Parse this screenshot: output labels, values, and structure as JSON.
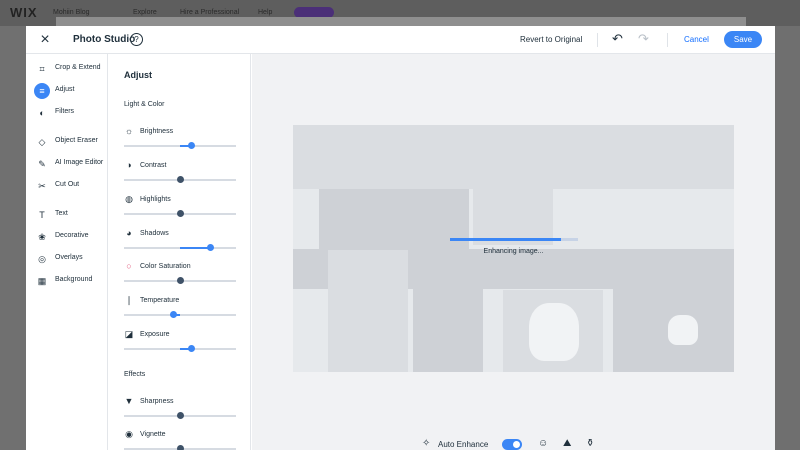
{
  "background": {
    "logo": "WIX",
    "items": [
      "Mohiin Blog",
      "Explore",
      "Hire a Professional",
      "Help"
    ],
    "upgrade": "Upgrade"
  },
  "header": {
    "title": "Photo Studio",
    "help_icon": "?",
    "revert": "Revert to Original",
    "cancel": "Cancel",
    "save": "Save"
  },
  "tools": [
    {
      "label": "Crop & Extend",
      "icon": "crop-icon"
    },
    {
      "label": "Adjust",
      "icon": "sliders-icon"
    },
    {
      "label": "Filters",
      "icon": "filters-icon"
    },
    {
      "label": "Object Eraser",
      "icon": "eraser-icon"
    },
    {
      "label": "AI Image Editor",
      "icon": "ai-edit-icon"
    },
    {
      "label": "Cut Out",
      "icon": "scissors-icon"
    },
    {
      "label": "Text",
      "icon": "text-icon"
    },
    {
      "label": "Decorative",
      "icon": "decorative-icon"
    },
    {
      "label": "Overlays",
      "icon": "overlays-icon"
    },
    {
      "label": "Background",
      "icon": "background-icon"
    }
  ],
  "adjust": {
    "title": "Adjust",
    "section_light": "Light & Color",
    "section_effects": "Effects",
    "controls": [
      {
        "label": "Brightness",
        "value": 0.6
      },
      {
        "label": "Contrast",
        "value": 0.5
      },
      {
        "label": "Highlights",
        "value": 0.5
      },
      {
        "label": "Shadows",
        "value": 0.77
      },
      {
        "label": "Color Saturation",
        "value": 0.5
      },
      {
        "label": "Temperature",
        "value": 0.44
      },
      {
        "label": "Exposure",
        "value": 0.6
      }
    ],
    "effects": [
      {
        "label": "Sharpness",
        "value": 0.5
      },
      {
        "label": "Vignette",
        "value": 0.5
      }
    ]
  },
  "canvas": {
    "status": "Enhancing image...",
    "progress": 0.87
  },
  "bottom": {
    "auto_enhance": "Auto Enhance",
    "auto_enhance_on": true
  },
  "colors": {
    "accent": "#3b86f5",
    "text": "#20303c"
  }
}
